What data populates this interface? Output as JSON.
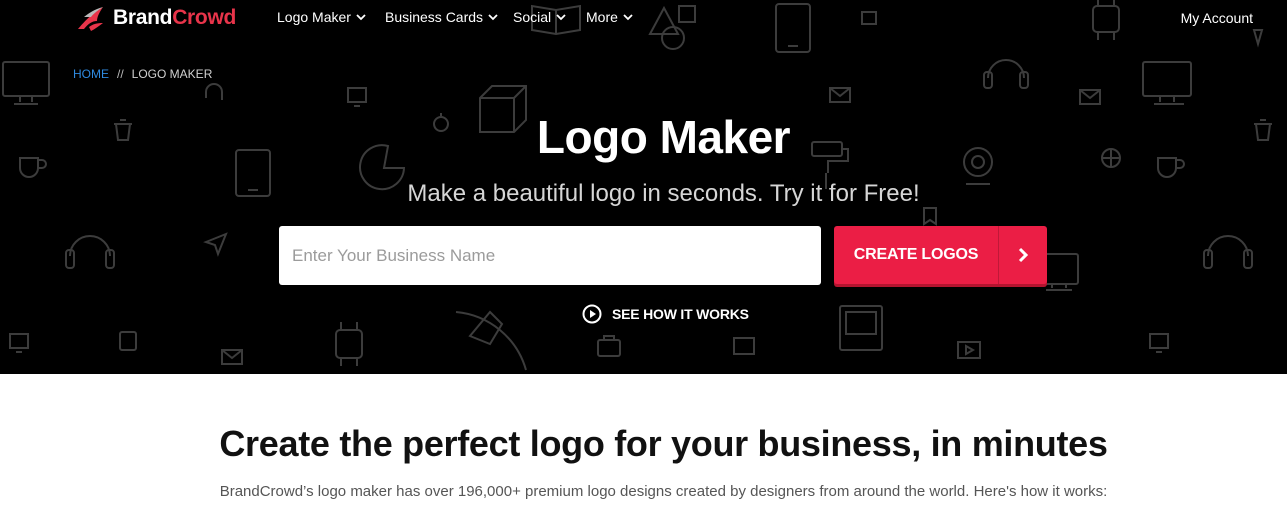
{
  "brand": {
    "name_part1": "Brand",
    "name_part2": "Crowd",
    "accent_color": "#e8344a"
  },
  "nav": {
    "items": [
      {
        "label": "Logo Maker"
      },
      {
        "label": "Business Cards"
      },
      {
        "label": "Social"
      },
      {
        "label": "More"
      }
    ],
    "account_label": "My Account"
  },
  "breadcrumb": {
    "home": "HOME",
    "separator": "//",
    "current": "LOGO MAKER"
  },
  "hero": {
    "title": "Logo Maker",
    "subtitle": "Make a beautiful logo in seconds. Try it for Free!",
    "search_placeholder": "Enter Your Business Name",
    "search_value": "",
    "cta_label": "CREATE LOGOS",
    "cta_color": "#eb1e45",
    "how_label": "SEE HOW IT WORKS"
  },
  "content": {
    "heading": "Create the perfect logo for your business, in minutes",
    "description": "BrandCrowd’s logo maker has over 196,000+ premium logo designs created by designers from around the world. Here's how it works:"
  }
}
